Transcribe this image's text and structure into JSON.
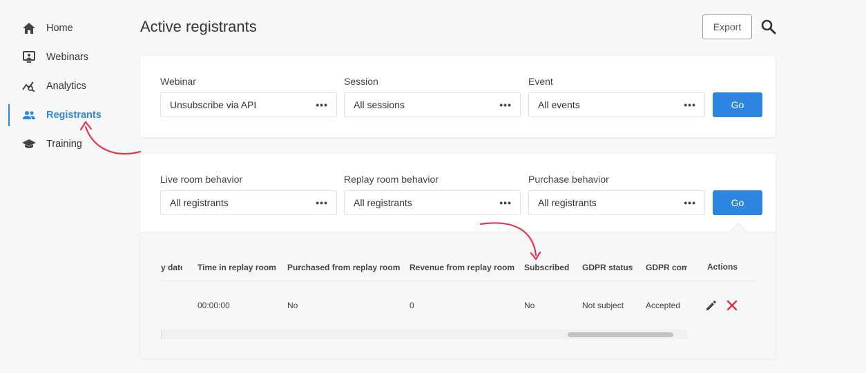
{
  "sidebar": {
    "items": [
      {
        "label": "Home",
        "icon": "home-icon"
      },
      {
        "label": "Webinars",
        "icon": "monitor-icon"
      },
      {
        "label": "Analytics",
        "icon": "analytics-icon"
      },
      {
        "label": "Registrants",
        "icon": "people-icon",
        "active": true
      },
      {
        "label": "Training",
        "icon": "graduation-cap-icon"
      }
    ]
  },
  "header": {
    "title": "Active registrants",
    "export_label": "Export",
    "search_icon": "search-icon"
  },
  "filters1": {
    "webinar": {
      "label": "Webinar",
      "value": "Unsubscribe via API"
    },
    "session": {
      "label": "Session",
      "value": "All sessions"
    },
    "event": {
      "label": "Event",
      "value": "All events"
    },
    "go_label": "Go"
  },
  "filters2": {
    "live": {
      "label": "Live room behavior",
      "value": "All registrants"
    },
    "replay": {
      "label": "Replay room behavior",
      "value": "All registrants"
    },
    "purchase": {
      "label": "Purchase behavior",
      "value": "All registrants"
    },
    "go_label": "Go"
  },
  "table": {
    "columns": [
      "y date",
      "Time in replay room",
      "Purchased from replay room",
      "Revenue from replay room",
      "Subscribed",
      "GDPR status",
      "GDPR com",
      "Actions"
    ],
    "row": [
      "00:00:00",
      "No",
      "0",
      "No",
      "Not subject",
      "Accepted"
    ],
    "actions": [
      "pencil-icon",
      "close-icon"
    ]
  },
  "colors": {
    "accent": "#2d87e0",
    "danger": "#e0303a",
    "annotation_arrow": "#e8344a"
  }
}
